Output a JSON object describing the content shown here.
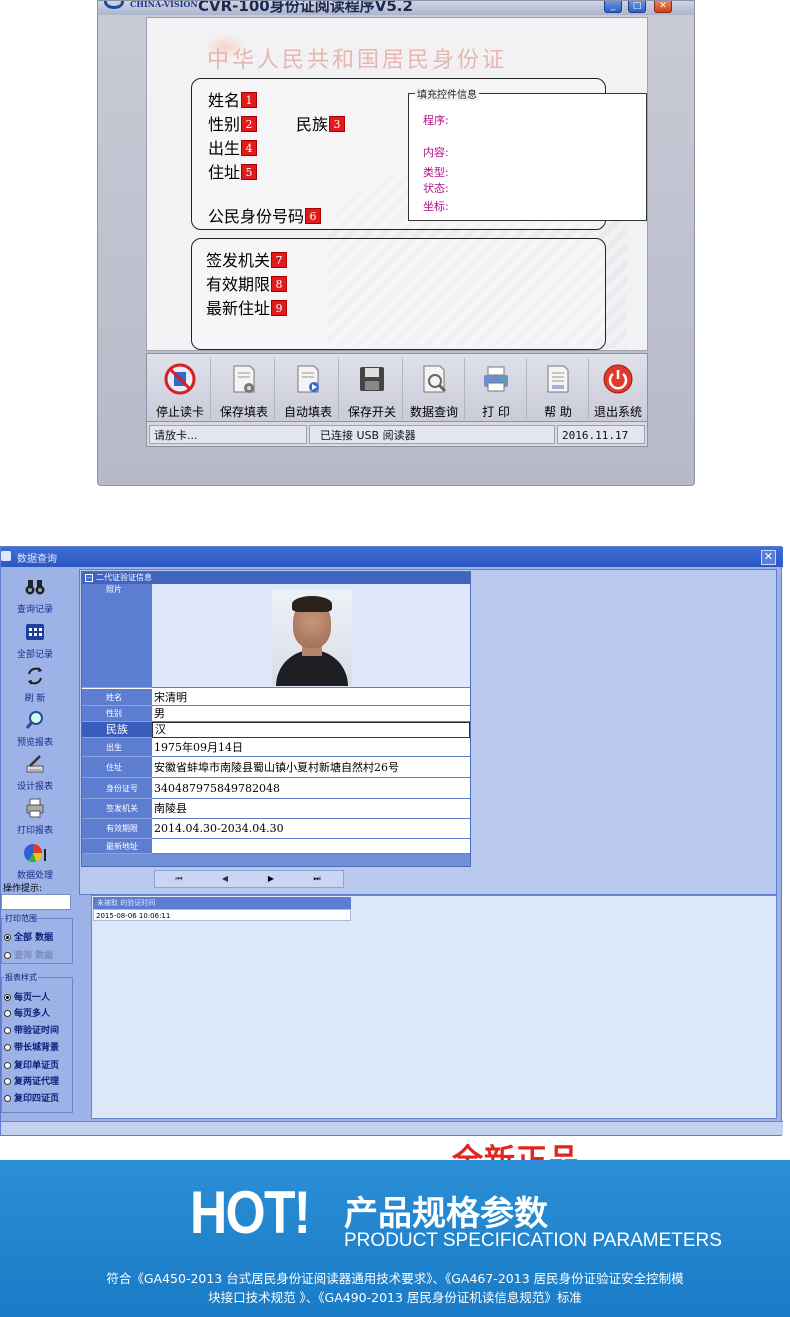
{
  "reader": {
    "brand": "CHINA-VISION",
    "title": "CVR-100身份证阅读程序V5.2",
    "watermark": "中华人民共和国居民身份证",
    "fields": {
      "name": {
        "label": "姓名",
        "badge": "1"
      },
      "gender": {
        "label": "性别",
        "badge": "2"
      },
      "ethnicity": {
        "label": "民族",
        "badge": "3"
      },
      "birth": {
        "label": "出生",
        "badge": "4"
      },
      "address": {
        "label": "住址",
        "badge": "5"
      },
      "id_number": {
        "label": "公民身份号码",
        "badge": "6"
      },
      "issuer": {
        "label": "签发机关",
        "badge": "7"
      },
      "validity": {
        "label": "有效期限",
        "badge": "8"
      },
      "new_address": {
        "label": "最新住址",
        "badge": "9"
      }
    },
    "info_box": {
      "legend": "填充控件信息",
      "program": "程序:",
      "content": "内容:",
      "type": "类型:",
      "state": "状态:",
      "coords": "坐标:"
    },
    "toolbar": [
      "停止读卡",
      "保存填表",
      "自动填表",
      "保存开关",
      "数据查询",
      "打 印",
      "帮 助",
      "退出系统"
    ],
    "status": {
      "prompt": "请放卡...",
      "connection": "已连接 USB 阅读器",
      "date": "2016.11.17"
    }
  },
  "query": {
    "title": "数据查询",
    "nav": [
      "查询记录",
      "全部记录",
      "刷 新",
      "预览报表",
      "设计报表",
      "打印报表",
      "数据处理"
    ],
    "hint_label": "操作提示:",
    "print_range": {
      "title": "打印范围",
      "options": [
        "全部 数据",
        "查询 数据"
      ]
    },
    "report_style": {
      "title": "报表样式",
      "options": [
        "每页一人",
        "每页多人",
        "带验证时间",
        "带长城背景",
        "复印单证页",
        "复两证代理",
        "复印四证页"
      ]
    },
    "verify": {
      "header": "二代证验证信息",
      "photo_label": "照片",
      "rows": [
        {
          "label": "姓名",
          "value": "宋清明"
        },
        {
          "label": "性别",
          "value": "男"
        },
        {
          "label": "民族",
          "value": "汉"
        },
        {
          "label": "出生",
          "value": "1975年09月14日"
        },
        {
          "label": "住址",
          "value": "安徽省蚌埠市南陵县蜀山镇小夏村新塘自然村26号"
        },
        {
          "label": "身份证号",
          "value": "340487975849782048"
        },
        {
          "label": "签发机关",
          "value": "南陵县"
        },
        {
          "label": "有效期限",
          "value": "2014.04.30-2034.04.30"
        },
        {
          "label": "最新地址",
          "value": ""
        }
      ]
    },
    "pager": [
      "⏮",
      "◀",
      "▶",
      "⏭"
    ],
    "log": {
      "header": "未被取 的验证时间",
      "row": "2015-08-06 10:06:11"
    }
  },
  "banner": {
    "new_label": "全新正品",
    "hot": "HOT!",
    "spec_cn": "产品规格参数",
    "spec_en": "PRODUCT SPECIFICATION PARAMETERS",
    "standards_line1": "符合《GA450-2013 台式居民身份证阅读器通用技术要求》、《GA467-2013 居民身份证验证安全控制模",
    "standards_line2": "块接口技术规范 》、《GA490-2013 居民身份证机读信息规范》标准"
  },
  "colors": {
    "badge": "#e01b1b",
    "nav_text": "#1a2b8f",
    "banner": "#1a7bc6",
    "new_label": "#e3251b",
    "info_label": "#b0128a"
  }
}
